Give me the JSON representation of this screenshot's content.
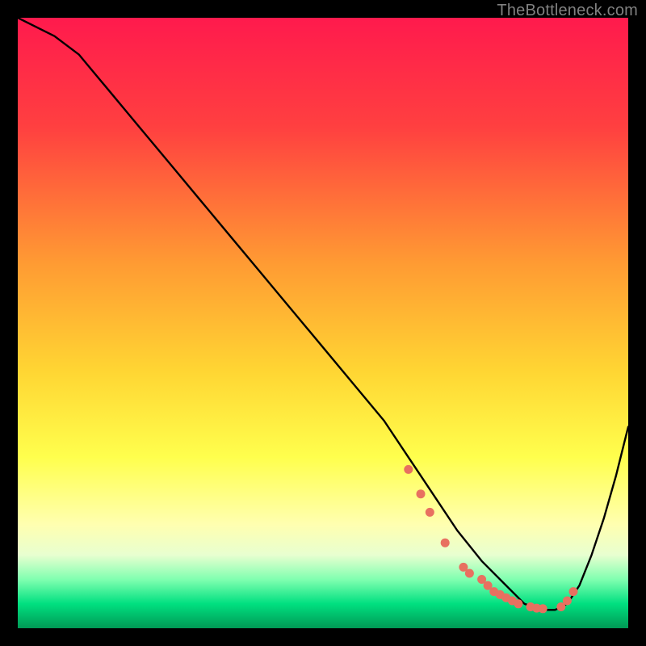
{
  "watermark": "TheBottleneck.com",
  "chart_data": {
    "type": "line",
    "title": "",
    "xlabel": "",
    "ylabel": "",
    "xlim": [
      0,
      100
    ],
    "ylim": [
      0,
      100
    ],
    "grid": false,
    "legend": false,
    "gradient_stops": [
      {
        "offset": 0,
        "color": "#ff1a4d"
      },
      {
        "offset": 18,
        "color": "#ff4040"
      },
      {
        "offset": 40,
        "color": "#ff9a33"
      },
      {
        "offset": 58,
        "color": "#ffd633"
      },
      {
        "offset": 72,
        "color": "#ffff4d"
      },
      {
        "offset": 83,
        "color": "#ffffb0"
      },
      {
        "offset": 88,
        "color": "#e8ffd0"
      },
      {
        "offset": 92,
        "color": "#80ffb0"
      },
      {
        "offset": 96,
        "color": "#00e080"
      },
      {
        "offset": 100,
        "color": "#009955"
      }
    ],
    "series": [
      {
        "name": "bottleneck-curve",
        "x": [
          0,
          6,
          10,
          15,
          20,
          25,
          30,
          35,
          40,
          45,
          50,
          55,
          60,
          64,
          68,
          72,
          76,
          80,
          83,
          86,
          88,
          90,
          92,
          94,
          96,
          98,
          100
        ],
        "y": [
          100,
          97,
          94,
          88,
          82,
          76,
          70,
          64,
          58,
          52,
          46,
          40,
          34,
          28,
          22,
          16,
          11,
          7,
          4,
          3,
          3,
          4,
          7,
          12,
          18,
          25,
          33
        ]
      }
    ],
    "markers": {
      "name": "highlight-points",
      "color": "#e87060",
      "x": [
        64,
        66,
        67.5,
        70,
        73,
        74,
        76,
        77,
        78,
        79,
        80,
        81,
        82,
        84,
        85,
        86,
        89,
        90,
        91
      ],
      "y": [
        26,
        22,
        19,
        14,
        10,
        9,
        8,
        7,
        6,
        5.5,
        5,
        4.5,
        4,
        3.5,
        3.3,
        3.2,
        3.5,
        4.5,
        6
      ]
    }
  }
}
